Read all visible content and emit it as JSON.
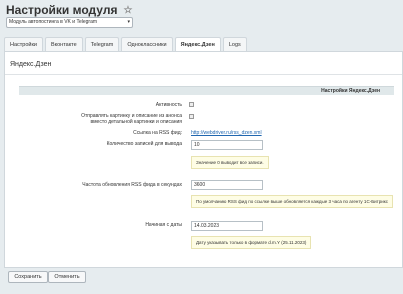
{
  "page": {
    "title": "Настройки модуля"
  },
  "module_select": {
    "value": "Модуль автопостинга в VK и Telegram"
  },
  "tabs": [
    "Настройки",
    "Вконтакте",
    "Telegram",
    "Одноклассники",
    "Яндекс.Дзен",
    "Logs"
  ],
  "panel": {
    "title": "Яндекс.Дзен",
    "section": "Настройки Яндекс.Дзен"
  },
  "fields": {
    "active_label": "Активность",
    "send_label_1": "Отправлять картинку и описание из анонса",
    "send_label_2": "вместо детальной картинки и описания",
    "rss_label": "Ссылка на RSS фид:",
    "rss_link": "http://webdriver.ru/rss_dzen.xml",
    "count_label": "Количество записей для вывода",
    "count_value": "10",
    "count_note": "Значение 0 выводит все записи.",
    "freq_label": "Частота обновления RSS фида в секундах",
    "freq_value": "3600",
    "freq_note": "По умолчанию RSS фид по ссылке выше обновляется каждые 3 часа по агенту 1С-Битрикс",
    "date_label": "Начиная с даты",
    "date_value": "14.03.2023",
    "date_note": "Дату указывать только в формате d.m.Y (25.11.2023)"
  },
  "buttons": {
    "save": "Сохранить",
    "cancel": "Отменить"
  }
}
